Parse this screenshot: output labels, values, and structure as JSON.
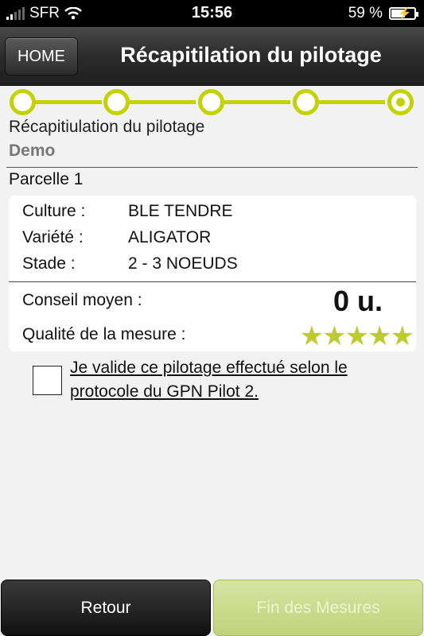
{
  "status_bar": {
    "carrier": "SFR",
    "time": "15:56",
    "battery": "59 %",
    "battery_level": 0.59
  },
  "nav": {
    "home_label": "HOME",
    "title": "Récapitilation du pilotage"
  },
  "steps": {
    "count": 5,
    "active_index": 4,
    "accent_color": "#c3d200"
  },
  "heading": "Récapitiulation du pilotage",
  "subheading": "Demo",
  "parcel": "Parcelle 1",
  "details": [
    {
      "label": "Culture :",
      "value": "BLE TENDRE"
    },
    {
      "label": "Variété :",
      "value": "ALIGATOR"
    },
    {
      "label": "Stade :",
      "value": "2 - 3 NOEUDS"
    }
  ],
  "conseil": {
    "label": "Conseil moyen :",
    "value": "0 u."
  },
  "quality": {
    "label": "Qualité de la mesure :",
    "stars": 5,
    "star_color": "#bccc2e"
  },
  "validation": {
    "text": "Je valide ce pilotage effectué selon le protocole du GPN Pilot 2.",
    "checked": false
  },
  "buttons": {
    "back": "Retour",
    "finish": "Fin des Mesures"
  }
}
